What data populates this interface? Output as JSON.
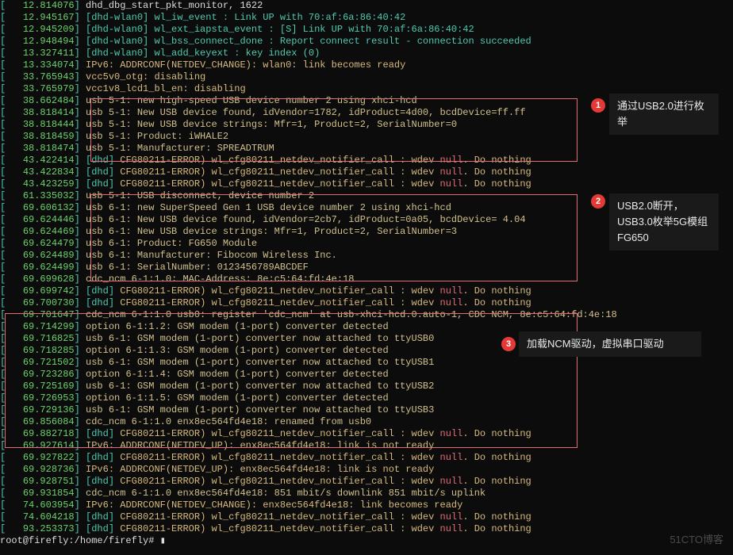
{
  "lines": [
    {
      "ts": "12.814076",
      "cls": "wh",
      "txt": "dhd_dbg_start_pkt_monitor, 1622"
    },
    {
      "ts": "12.945167",
      "cls": "cy",
      "txt": "[dhd-wlan0] wl_iw_event : Link UP with 70:af:6a:86:40:42"
    },
    {
      "ts": "12.945209",
      "cls": "cy",
      "txt": "[dhd-wlan0] wl_ext_iapsta_event : [S] Link UP with 70:af:6a:86:40:42"
    },
    {
      "ts": "12.948494",
      "cls": "cy",
      "txt": "[dhd-wlan0] wl_bss_connect_done : Report connect result - connection succeeded"
    },
    {
      "ts": "13.327411",
      "cls": "cy",
      "txt": "[dhd-wlan0] wl_add_keyext : key index (0)"
    },
    {
      "ts": "13.334074",
      "cls": "yl",
      "txt": "IPv6: ADDRCONF(NETDEV_CHANGE): wlan0: link becomes ready"
    },
    {
      "ts": "33.765943",
      "cls": "yl",
      "txt": "vcc5v0_otg: disabling"
    },
    {
      "ts": "33.765979",
      "cls": "yl",
      "txt": "vcc1v8_lcd1_bl_en: disabling"
    },
    {
      "ts": "38.662484",
      "cls": "bw",
      "txt": "usb 5-1: new high-speed USB device number 2 using xhci-hcd"
    },
    {
      "ts": "38.818414",
      "cls": "bw",
      "txt": "usb 5-1: New USB device found, idVendor=1782, idProduct=4d00, bcdDevice=ff.ff"
    },
    {
      "ts": "38.818444",
      "cls": "bw",
      "txt": "usb 5-1: New USB device strings: Mfr=1, Product=2, SerialNumber=0"
    },
    {
      "ts": "38.818459",
      "cls": "bw",
      "txt": "usb 5-1: Product: iWHALE2"
    },
    {
      "ts": "38.818474",
      "cls": "bw",
      "txt": "usb 5-1: Manufacturer: SPREADTRUM"
    },
    {
      "ts": "43.422414",
      "cls": "mix1",
      "txt": "[dhd] CFG80211-ERROR) wl_cfg80211_netdev_notifier_call : wdev null. Do nothing"
    },
    {
      "ts": "43.422834",
      "cls": "mix1",
      "txt": "[dhd] CFG80211-ERROR) wl_cfg80211_netdev_notifier_call : wdev null. Do nothing"
    },
    {
      "ts": "43.423259",
      "cls": "mix1",
      "txt": "[dhd] CFG80211-ERROR) wl_cfg80211_netdev_notifier_call : wdev null. Do nothing"
    },
    {
      "ts": "61.335032",
      "cls": "bw",
      "txt": "usb 5-1: USB disconnect, device number 2"
    },
    {
      "ts": "69.606132",
      "cls": "bw",
      "txt": "usb 6-1: new SuperSpeed Gen 1 USB device number 2 using xhci-hcd"
    },
    {
      "ts": "69.624446",
      "cls": "bw",
      "txt": "usb 6-1: New USB device found, idVendor=2cb7, idProduct=0a05, bcdDevice= 4.04"
    },
    {
      "ts": "69.624469",
      "cls": "bw",
      "txt": "usb 6-1: New USB device strings: Mfr=1, Product=2, SerialNumber=3"
    },
    {
      "ts": "69.624479",
      "cls": "bw",
      "txt": "usb 6-1: Product: FG650 Module"
    },
    {
      "ts": "69.624489",
      "cls": "bw",
      "txt": "usb 6-1: Manufacturer: Fibocom Wireless Inc."
    },
    {
      "ts": "69.624499",
      "cls": "bw",
      "txt": "usb 6-1: SerialNumber: 0123456789ABCDEF"
    },
    {
      "ts": "69.699628",
      "cls": "bw",
      "txt": "cdc_ncm 6-1:1.0: MAC-Address: 8e:c5:64:fd:4e:18"
    },
    {
      "ts": "69.699742",
      "cls": "mix1",
      "txt": "[dhd] CFG80211-ERROR) wl_cfg80211_netdev_notifier_call : wdev null. Do nothing"
    },
    {
      "ts": "69.700730",
      "cls": "mix1",
      "txt": "[dhd] CFG80211-ERROR) wl_cfg80211_netdev_notifier_call : wdev null. Do nothing"
    },
    {
      "ts": "69.701647",
      "cls": "bw",
      "txt": "cdc_ncm 6-1:1.0 usb0: register 'cdc_ncm' at usb-xhci-hcd.0.auto-1, CDC NCM, 8e:c5:64:fd:4e:18"
    },
    {
      "ts": "69.714299",
      "cls": "bw",
      "txt": "option 6-1:1.2: GSM modem (1-port) converter detected"
    },
    {
      "ts": "69.716825",
      "cls": "bw",
      "txt": "usb 6-1: GSM modem (1-port) converter now attached to ttyUSB0"
    },
    {
      "ts": "69.718285",
      "cls": "bw",
      "txt": "option 6-1:1.3: GSM modem (1-port) converter detected"
    },
    {
      "ts": "69.721502",
      "cls": "bw",
      "txt": "usb 6-1: GSM modem (1-port) converter now attached to ttyUSB1"
    },
    {
      "ts": "69.723286",
      "cls": "bw",
      "txt": "option 6-1:1.4: GSM modem (1-port) converter detected"
    },
    {
      "ts": "69.725169",
      "cls": "bw",
      "txt": "usb 6-1: GSM modem (1-port) converter now attached to ttyUSB2"
    },
    {
      "ts": "69.726953",
      "cls": "bw",
      "txt": "option 6-1:1.5: GSM modem (1-port) converter detected"
    },
    {
      "ts": "69.729136",
      "cls": "bw",
      "txt": "usb 6-1: GSM modem (1-port) converter now attached to ttyUSB3"
    },
    {
      "ts": "69.856084",
      "cls": "bw",
      "txt": "cdc_ncm 6-1:1.0 enx8ec564fd4e18: renamed from usb0"
    },
    {
      "ts": "69.882718",
      "cls": "mix1",
      "txt": "[dhd] CFG80211-ERROR) wl_cfg80211_netdev_notifier_call : wdev null. Do nothing"
    },
    {
      "ts": "69.927614",
      "cls": "yl",
      "txt": "IPv6: ADDRCONF(NETDEV_UP): enx8ec564fd4e18: link is not ready"
    },
    {
      "ts": "69.927822",
      "cls": "mix1",
      "txt": "[dhd] CFG80211-ERROR) wl_cfg80211_netdev_notifier_call : wdev null. Do nothing"
    },
    {
      "ts": "69.928736",
      "cls": "yl",
      "txt": "IPv6: ADDRCONF(NETDEV_UP): enx8ec564fd4e18: link is not ready"
    },
    {
      "ts": "69.928751",
      "cls": "mix1",
      "txt": "[dhd] CFG80211-ERROR) wl_cfg80211_netdev_notifier_call : wdev null. Do nothing"
    },
    {
      "ts": "69.931854",
      "cls": "bw",
      "txt": "cdc_ncm 6-1:1.0 enx8ec564fd4e18: 851 mbit/s downlink 851 mbit/s uplink"
    },
    {
      "ts": "74.603954",
      "cls": "yl",
      "txt": "IPv6: ADDRCONF(NETDEV_CHANGE): enx8ec564fd4e18: link becomes ready"
    },
    {
      "ts": "74.604218",
      "cls": "mix1",
      "txt": "[dhd] CFG80211-ERROR) wl_cfg80211_netdev_notifier_call : wdev null. Do nothing"
    },
    {
      "ts": "93.253373",
      "cls": "mix1",
      "txt": "[dhd] CFG80211-ERROR) wl_cfg80211_netdev_notifier_call : wdev null. Do nothing"
    }
  ],
  "prompt": "root@firefly:/home/firefly# ",
  "cursor": "▮",
  "annotations": {
    "a1": {
      "num": "1",
      "text": "通过USB2.0进行枚举"
    },
    "a2": {
      "num": "2",
      "text": "USB2.0断开，USB3.0枚举5G模组FG650"
    },
    "a3": {
      "num": "3",
      "text": "加载NCM驱动，虚拟串口驱动"
    }
  },
  "watermark": "51CTO博客"
}
